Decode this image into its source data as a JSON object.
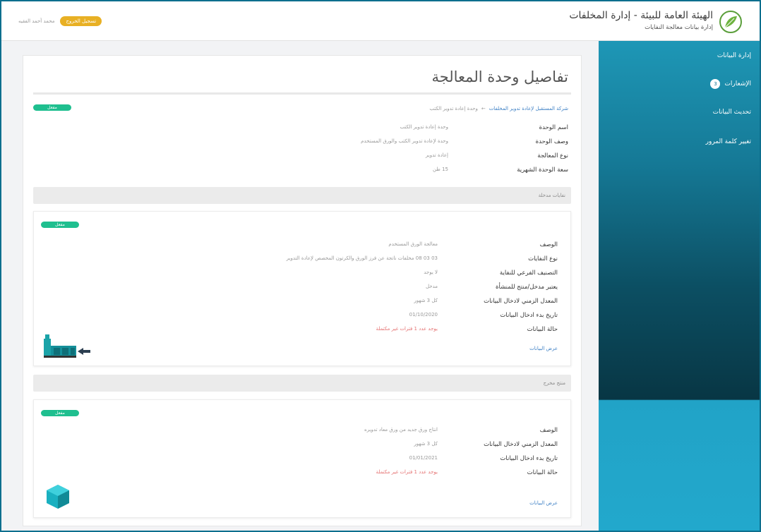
{
  "header": {
    "org_title": "الهيئة العامة للبيئة - إدارة المخلفات",
    "org_subtitle": "إدارة بيانات معالجة النفايات",
    "user_name": "محمد أحمد الفقيه",
    "logout_label": "تسجيل الخروج"
  },
  "sidebar": {
    "items": [
      {
        "label": "إدارة البيانات"
      },
      {
        "label": "الإشعارات",
        "badge": "3"
      },
      {
        "label": "تحديث البيانات"
      },
      {
        "label": "تغيير كلمة المرور"
      }
    ]
  },
  "page": {
    "title": "تفاصيل وحدة المعالجة",
    "status": "مفعل",
    "breadcrumb": {
      "link": "شركة المستقبل لإعادة تدوير المخلفات",
      "separator": "←",
      "current": "وحدة إعادة تدوير الكتب"
    },
    "unit": {
      "fields": [
        {
          "label": "اسم الوحدة",
          "value": "وحدة إعادة تدوير الكتب"
        },
        {
          "label": "وصف الوحدة",
          "value": "وحدة لإعادة تدوير الكتب والورق المستخدم"
        },
        {
          "label": "نوع المعالجة",
          "value": "إعادة تدوير"
        },
        {
          "label": "سعة الوحدة الشهرية",
          "value": "15 طن"
        }
      ]
    }
  },
  "inputs_section": {
    "title": "نفايات مدخلة",
    "card": {
      "status": "مفعل",
      "fields": [
        {
          "label": "الوصف",
          "value": "معالجة الورق المستخدم"
        },
        {
          "label": "نوع النفايات",
          "value": "03 03 08 مخلفات ناتجة عن فرز الورق والكرتون المخصص لإعادة التدوير"
        },
        {
          "label": "التصنيف الفرعي للنفاية",
          "value": "لا يوجد"
        },
        {
          "label": "يعتبر مدخل/منتج للمنشأة",
          "value": "مدخل"
        },
        {
          "label": "المعدل الزمني لادخال البيانات",
          "value": "كل 3 شهور"
        },
        {
          "label": "تاريخ بدء ادخال البيانات",
          "value": "01/10/2020"
        },
        {
          "label": "حالة البيانات",
          "value": "يوجد عدد 1 فترات غير مكتملة",
          "warn": true
        }
      ],
      "link": "عرض البيانات",
      "icon": "factory-input-icon"
    }
  },
  "outputs_section": {
    "title": "منتج مخرج",
    "card": {
      "status": "مفعل",
      "fields": [
        {
          "label": "الوصف",
          "value": "انتاج ورق جديد من ورق معاد تدويره"
        },
        {
          "label": "المعدل الزمني لادخال البيانات",
          "value": "كل 3 شهور"
        },
        {
          "label": "تاريخ بدء ادخال البيانات",
          "value": "01/01/2021"
        },
        {
          "label": "حالة البيانات",
          "value": "يوجد عدد 1 فترات غير مكتملة",
          "warn": true
        }
      ],
      "link": "عرض البيانات",
      "icon": "product-box-icon"
    }
  },
  "colors": {
    "sidebar_primary": "#157996",
    "sidebar_dark": "#083644",
    "status_green": "#1fbf8f",
    "logout_yellow": "#e8b024",
    "link_blue": "#3c7fc4",
    "warn_red": "#e57373"
  }
}
